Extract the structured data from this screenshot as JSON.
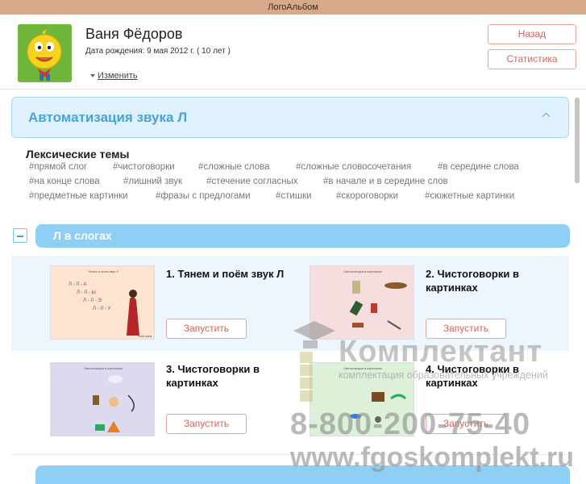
{
  "window": {
    "title": "ЛогоАльбом"
  },
  "profile": {
    "name": "Ваня Фёдоров",
    "birth_date": "Дата рождения: 9 мая 2012 г. ( 10 лет )",
    "edit_label": "Изменить",
    "back_label": "Назад",
    "stats_label": "Статистика"
  },
  "section": {
    "title": "Автоматизация звука Л",
    "lexical_title": "Лексические темы",
    "tags": [
      "#прямой слог",
      "#чистоговорки",
      "#сложные слова",
      "#сложные словосочетания",
      "#в середине слова",
      "#на конце слова",
      "#лишний звук",
      "#стечение согласных",
      "#в начале и в середине слов",
      "#предметные картинки",
      "#фразы с предлогами",
      "#стишки",
      "#скороговорки",
      "#сюжетные картинки"
    ]
  },
  "group": {
    "title": "Л в слогах",
    "cards": [
      {
        "title": "1. Тянем и поём звук Л",
        "run_label": "Запустить",
        "thumb_title": "Тянем и поём звук Л",
        "syllables": [
          "Л - Л - А",
          "Л - Л - Ы",
          "Л - Л - Э",
          "Л - Л - У"
        ],
        "thumb_footer": "Знай поём"
      },
      {
        "title": "2. Чистоговорки в картинках",
        "run_label": "Запустить",
        "thumb_title": "Чистоговорки в картинках"
      },
      {
        "title": "3. Чистоговорки в картинках",
        "run_label": "Запустить",
        "thumb_title": "Чистоговорки в картинках"
      },
      {
        "title": "4. Чистоговорки в картинках",
        "run_label": "Запустить",
        "thumb_title": "Чистоговорки в картинках"
      }
    ]
  },
  "watermark": {
    "name": "Комплектант",
    "subtitle": "комплектация образовательных учреждений",
    "phone": "8-800-200-75-40",
    "url": "www.fgoskomplekt.ru"
  },
  "colors": {
    "titlebar": "#d7a98a",
    "accent_blue": "#4aa3d8",
    "button_red": "#d4645a",
    "group_bar": "#8ecff5"
  }
}
